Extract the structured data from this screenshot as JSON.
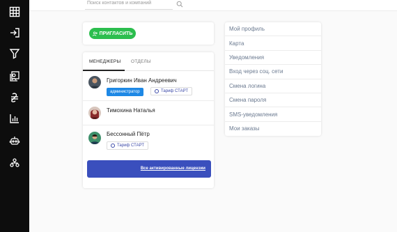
{
  "search": {
    "placeholder": "Поиск контактов и компаний"
  },
  "invite": {
    "label": "ПРИГЛАСИТЬ"
  },
  "tabs": [
    {
      "label": "МЕНЕДЖЕРЫ",
      "active": true
    },
    {
      "label": "ОТДЕЛЫ",
      "active": false
    }
  ],
  "users": [
    {
      "name": "Григоркин Иван Андреевич",
      "role": "администратор",
      "tariff": "Тариф СТАРТ"
    },
    {
      "name": "Тимохина Наталья"
    },
    {
      "name": "Бессонный Пётр",
      "tariff": "Тариф СТАРТ"
    }
  ],
  "licenses": {
    "link": "Все активированные лицензии"
  },
  "profile_menu": [
    "Мой профиль",
    "Карта",
    "Уведомления",
    "Вход через соц. сети",
    "Смена логина",
    "Смена пароля",
    "SMS-уведомления",
    "Мои заказы"
  ],
  "colors": {
    "sidebar": "#0d0d0d",
    "invite": "#2cbe4e",
    "admin_badge": "#1e88e5",
    "licenses_bar": "#3a4fbd",
    "menu_text": "#6b7a90"
  },
  "sidebar_icons": [
    "grid-icon",
    "login-icon",
    "filter-icon",
    "contacts-icon",
    "currency-icon",
    "bar-chart-icon",
    "robot-icon",
    "org-structure-icon"
  ]
}
